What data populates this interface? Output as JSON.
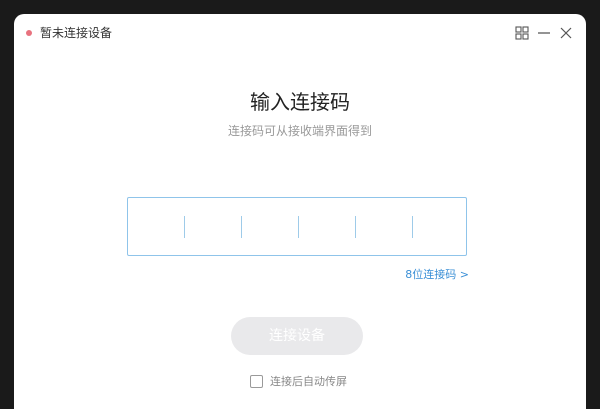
{
  "window": {
    "title": "暂未连接设备",
    "status_color": "#e8727e"
  },
  "main": {
    "heading": "输入连接码",
    "subheading": "连接码可从接收端界面得到",
    "code_input": {
      "slots": 6,
      "values": [
        "",
        "",
        "",
        "",
        "",
        ""
      ]
    },
    "code_length_link": "8位连接码 >",
    "connect_button": "连接设备",
    "auto_cast": {
      "label": "连接后自动传屏",
      "checked": false
    }
  },
  "colors": {
    "accent": "#3a8fd6",
    "input_border": "#8fc4ea",
    "button_disabled": "#e9e9eb"
  },
  "icons": {
    "grid": "grid-icon",
    "minimize": "minimize-icon",
    "close": "close-icon"
  }
}
